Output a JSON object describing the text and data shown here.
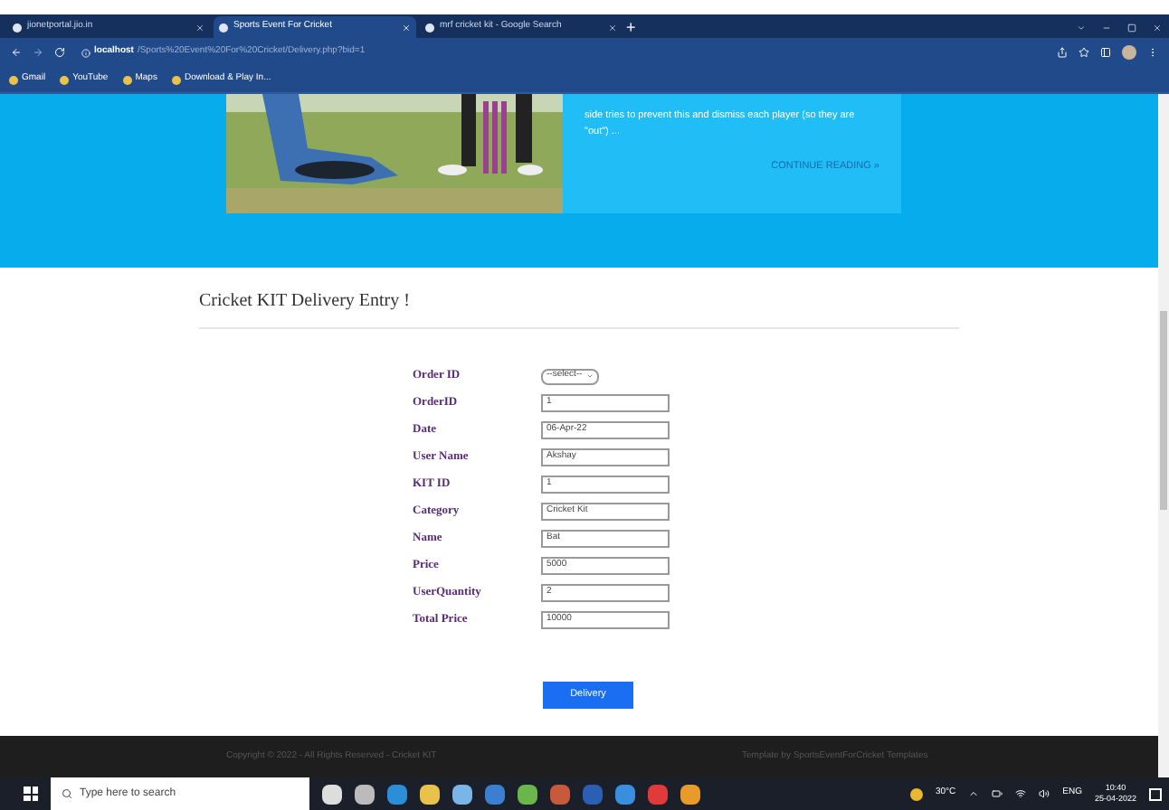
{
  "browser": {
    "tabs": [
      {
        "title": "jionetportal.jio.in",
        "selected": false
      },
      {
        "title": "Sports Event For Cricket",
        "selected": true
      },
      {
        "title": "mrf cricket kit - Google Search",
        "selected": false
      }
    ],
    "new_tab": "+",
    "url_host": "localhost",
    "url_path": "/Sports%20Event%20For%20Cricket/Delivery.php?bid=1",
    "bookmarks": [
      "Gmail",
      "YouTube",
      "Maps",
      "Download & Play In..."
    ]
  },
  "banner": {
    "text": "side tries to prevent this and dismiss each player (so they are \"out\") ...",
    "link": "CONTINUE READING »"
  },
  "form": {
    "title": "Cricket KIT Delivery Entry !",
    "fields": [
      {
        "label": "Order ID",
        "kind": "select",
        "value": "--select--"
      },
      {
        "label": "OrderID",
        "kind": "text",
        "value": "1"
      },
      {
        "label": "Date",
        "kind": "text",
        "value": "06-Apr-22"
      },
      {
        "label": "User Name",
        "kind": "text",
        "value": "Akshay"
      },
      {
        "label": "KIT ID",
        "kind": "text",
        "value": "1"
      },
      {
        "label": "Category",
        "kind": "text",
        "value": "Cricket Kit"
      },
      {
        "label": "Name",
        "kind": "text",
        "value": "Bat"
      },
      {
        "label": "Price",
        "kind": "text",
        "value": "5000"
      },
      {
        "label": "UserQuantity",
        "kind": "text",
        "value": "2"
      },
      {
        "label": "Total Price",
        "kind": "text",
        "value": "10000"
      }
    ],
    "button": "Delivery"
  },
  "footer": {
    "copyright": "Copyright © 2022 - All Rights Reserved - Cricket KIT",
    "credit": "Template by SportsEventForCricket Templates"
  },
  "taskbar": {
    "search_placeholder": "Type here to search",
    "weather": "30°C",
    "language": "ENG",
    "time": "10:40",
    "date": "25-04-2022"
  }
}
